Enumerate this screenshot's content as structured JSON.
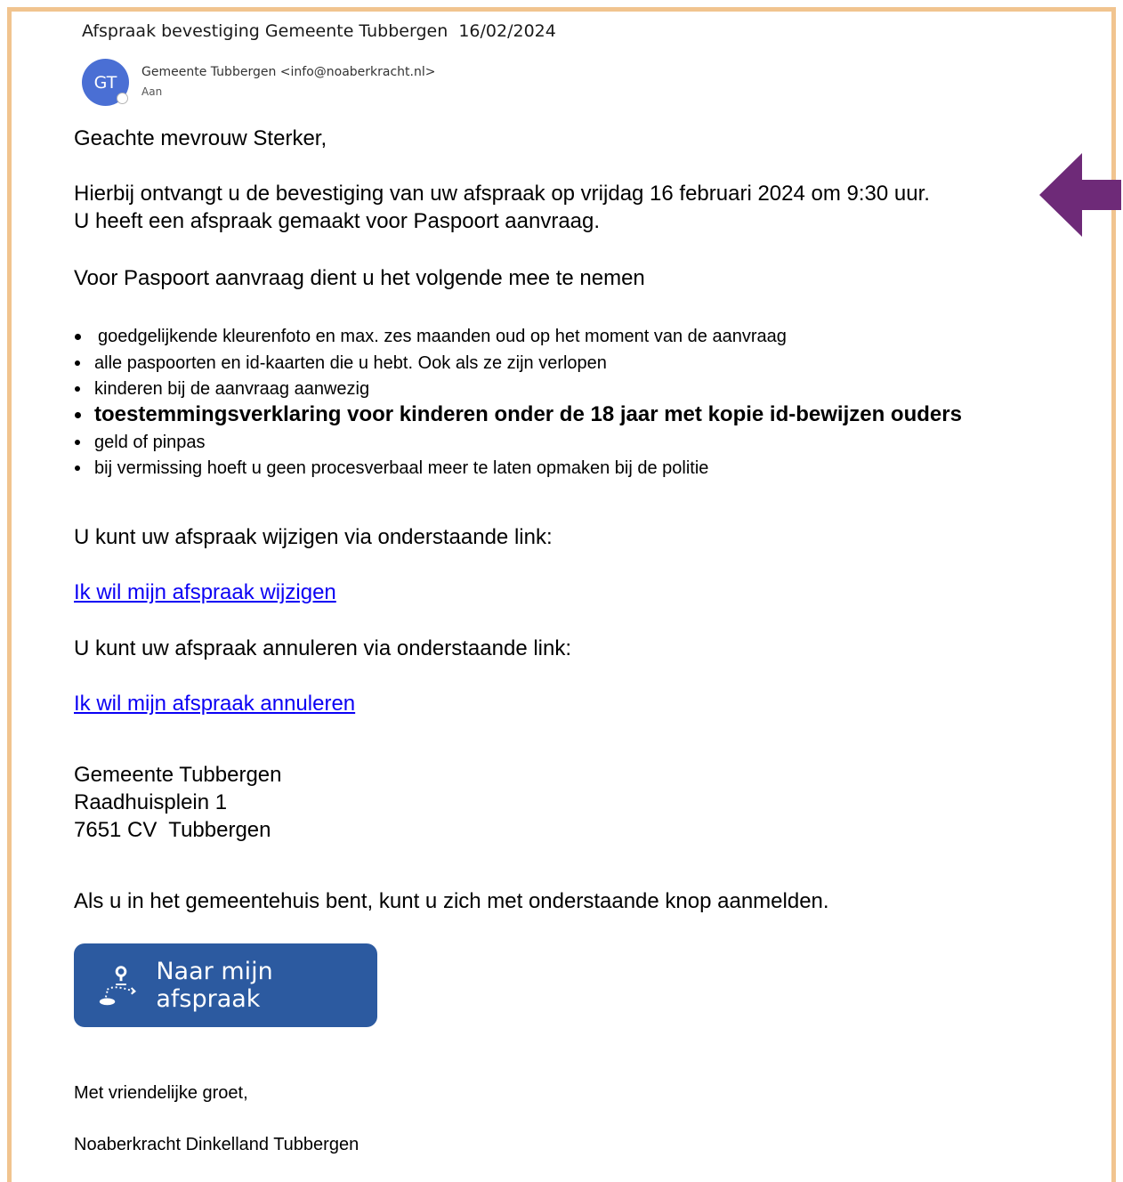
{
  "email": {
    "subject": "Afspraak bevestiging Gemeente Tubbergen  16/02/2024",
    "avatar_initials": "GT",
    "sender": "Gemeente Tubbergen <info@noaberkracht.nl>",
    "to_label": "Aan"
  },
  "body": {
    "greeting": "Geachte mevrouw Sterker,",
    "confirmation": "Hierbij ontvangt u de bevestiging van uw afspraak op vrijdag 16 februari 2024 om 9:30 uur.",
    "appointment_type": "U heeft een afspraak gemaakt voor Paspoort aanvraag.",
    "bring_intro": "Voor Paspoort aanvraag dient u het volgende mee te nemen",
    "bring_items": [
      "goedgelijkende kleurenfoto en max. zes maanden oud op het moment van de aanvraag",
      "alle paspoorten en id-kaarten die u hebt. Ook als ze zijn verlopen",
      "kinderen bij de aanvraag aanwezig",
      "toestemmingsverklaring voor kinderen onder de 18 jaar met kopie id-bewijzen ouders",
      "geld of pinpas",
      "bij vermissing hoeft u geen procesverbaal meer te laten opmaken bij de politie"
    ],
    "change_intro": "U kunt uw afspraak wijzigen via onderstaande link:",
    "change_link": "Ik wil mijn afspraak wijzigen",
    "cancel_intro": "U kunt uw afspraak annuleren via onderstaande link:",
    "cancel_link": "Ik wil mijn afspraak annuleren",
    "address": {
      "name": "Gemeente Tubbergen",
      "street": "Raadhuisplein 1",
      "city": "7651 CV  Tubbergen"
    },
    "checkin_text": "Als u in het gemeentehuis bent, kunt u zich met onderstaande knop aanmelden.",
    "button_label": "Naar mijn afspraak",
    "closing": "Met vriendelijke groet,",
    "signature": "Noaberkracht Dinkelland Tubbergen"
  },
  "colors": {
    "frame": "#f1c48f",
    "arrow": "#6e2a78",
    "button": "#2c5aa0",
    "link": "#0b00f4",
    "avatar": "#4a6fd4"
  },
  "icons": {
    "annotation": "arrow-left-icon",
    "button": "location-route-icon"
  }
}
